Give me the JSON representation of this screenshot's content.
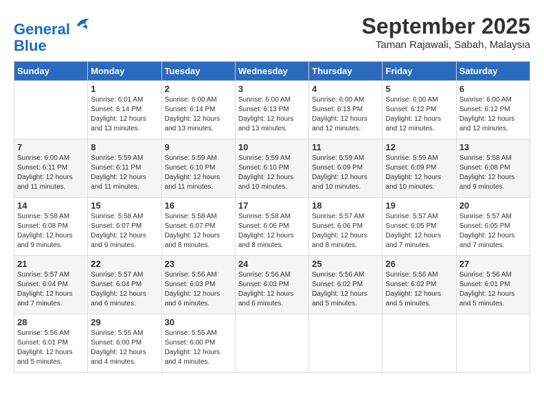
{
  "header": {
    "logo_line1": "General",
    "logo_line2": "Blue",
    "month": "September 2025",
    "location": "Taman Rajawali, Sabah, Malaysia"
  },
  "days_of_week": [
    "Sunday",
    "Monday",
    "Tuesday",
    "Wednesday",
    "Thursday",
    "Friday",
    "Saturday"
  ],
  "weeks": [
    [
      {
        "day": "",
        "info": ""
      },
      {
        "day": "1",
        "info": "Sunrise: 6:01 AM\nSunset: 6:14 PM\nDaylight: 12 hours\nand 13 minutes."
      },
      {
        "day": "2",
        "info": "Sunrise: 6:00 AM\nSunset: 6:14 PM\nDaylight: 12 hours\nand 13 minutes."
      },
      {
        "day": "3",
        "info": "Sunrise: 6:00 AM\nSunset: 6:13 PM\nDaylight: 12 hours\nand 13 minutes."
      },
      {
        "day": "4",
        "info": "Sunrise: 6:00 AM\nSunset: 6:13 PM\nDaylight: 12 hours\nand 12 minutes."
      },
      {
        "day": "5",
        "info": "Sunrise: 6:00 AM\nSunset: 6:12 PM\nDaylight: 12 hours\nand 12 minutes."
      },
      {
        "day": "6",
        "info": "Sunrise: 6:00 AM\nSunset: 6:12 PM\nDaylight: 12 hours\nand 12 minutes."
      }
    ],
    [
      {
        "day": "7",
        "info": "Sunrise: 6:00 AM\nSunset: 6:11 PM\nDaylight: 12 hours\nand 11 minutes."
      },
      {
        "day": "8",
        "info": "Sunrise: 5:59 AM\nSunset: 6:11 PM\nDaylight: 12 hours\nand 11 minutes."
      },
      {
        "day": "9",
        "info": "Sunrise: 5:59 AM\nSunset: 6:10 PM\nDaylight: 12 hours\nand 11 minutes."
      },
      {
        "day": "10",
        "info": "Sunrise: 5:59 AM\nSunset: 6:10 PM\nDaylight: 12 hours\nand 10 minutes."
      },
      {
        "day": "11",
        "info": "Sunrise: 5:59 AM\nSunset: 6:09 PM\nDaylight: 12 hours\nand 10 minutes."
      },
      {
        "day": "12",
        "info": "Sunrise: 5:59 AM\nSunset: 6:09 PM\nDaylight: 12 hours\nand 10 minutes."
      },
      {
        "day": "13",
        "info": "Sunrise: 5:58 AM\nSunset: 6:08 PM\nDaylight: 12 hours\nand 9 minutes."
      }
    ],
    [
      {
        "day": "14",
        "info": "Sunrise: 5:58 AM\nSunset: 6:08 PM\nDaylight: 12 hours\nand 9 minutes."
      },
      {
        "day": "15",
        "info": "Sunrise: 5:58 AM\nSunset: 6:07 PM\nDaylight: 12 hours\nand 9 minutes."
      },
      {
        "day": "16",
        "info": "Sunrise: 5:58 AM\nSunset: 6:07 PM\nDaylight: 12 hours\nand 8 minutes."
      },
      {
        "day": "17",
        "info": "Sunrise: 5:58 AM\nSunset: 6:06 PM\nDaylight: 12 hours\nand 8 minutes."
      },
      {
        "day": "18",
        "info": "Sunrise: 5:57 AM\nSunset: 6:06 PM\nDaylight: 12 hours\nand 8 minutes."
      },
      {
        "day": "19",
        "info": "Sunrise: 5:57 AM\nSunset: 6:05 PM\nDaylight: 12 hours\nand 7 minutes."
      },
      {
        "day": "20",
        "info": "Sunrise: 5:57 AM\nSunset: 6:05 PM\nDaylight: 12 hours\nand 7 minutes."
      }
    ],
    [
      {
        "day": "21",
        "info": "Sunrise: 5:57 AM\nSunset: 6:04 PM\nDaylight: 12 hours\nand 7 minutes."
      },
      {
        "day": "22",
        "info": "Sunrise: 5:57 AM\nSunset: 6:04 PM\nDaylight: 12 hours\nand 6 minutes."
      },
      {
        "day": "23",
        "info": "Sunrise: 5:56 AM\nSunset: 6:03 PM\nDaylight: 12 hours\nand 6 minutes."
      },
      {
        "day": "24",
        "info": "Sunrise: 5:56 AM\nSunset: 6:03 PM\nDaylight: 12 hours\nand 6 minutes."
      },
      {
        "day": "25",
        "info": "Sunrise: 5:56 AM\nSunset: 6:02 PM\nDaylight: 12 hours\nand 5 minutes."
      },
      {
        "day": "26",
        "info": "Sunrise: 5:56 AM\nSunset: 6:02 PM\nDaylight: 12 hours\nand 5 minutes."
      },
      {
        "day": "27",
        "info": "Sunrise: 5:56 AM\nSunset: 6:01 PM\nDaylight: 12 hours\nand 5 minutes."
      }
    ],
    [
      {
        "day": "28",
        "info": "Sunrise: 5:56 AM\nSunset: 6:01 PM\nDaylight: 12 hours\nand 5 minutes."
      },
      {
        "day": "29",
        "info": "Sunrise: 5:55 AM\nSunset: 6:00 PM\nDaylight: 12 hours\nand 4 minutes."
      },
      {
        "day": "30",
        "info": "Sunrise: 5:55 AM\nSunset: 6:00 PM\nDaylight: 12 hours\nand 4 minutes."
      },
      {
        "day": "",
        "info": ""
      },
      {
        "day": "",
        "info": ""
      },
      {
        "day": "",
        "info": ""
      },
      {
        "day": "",
        "info": ""
      }
    ]
  ]
}
